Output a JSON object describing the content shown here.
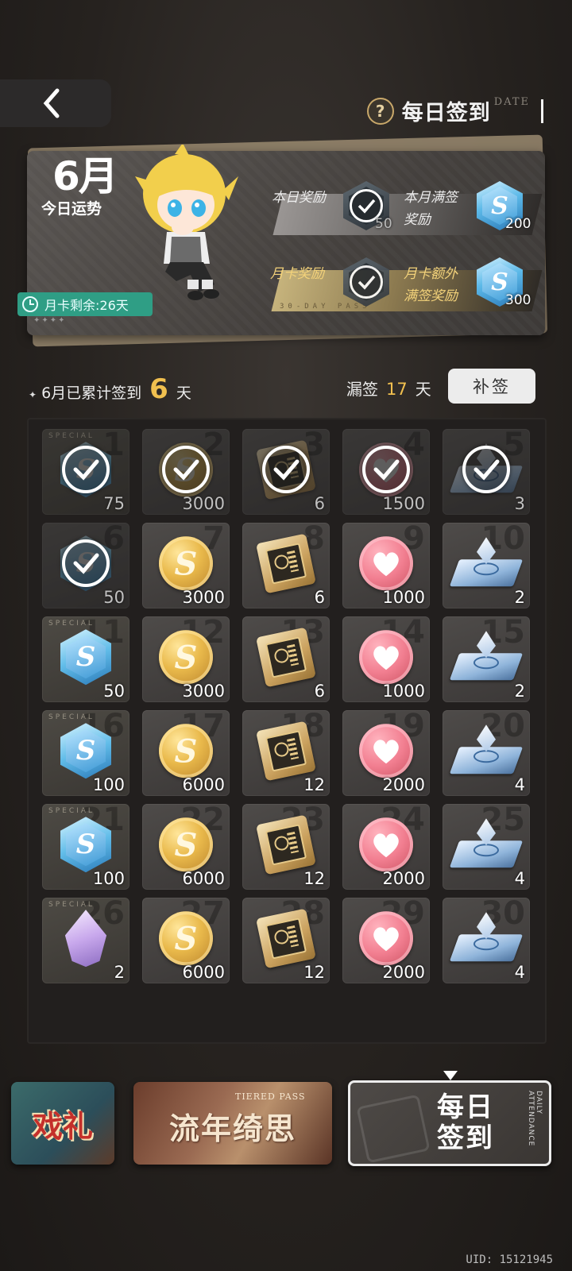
{
  "header": {
    "title": "每日签到",
    "date_tag": "DATE"
  },
  "card": {
    "month": "6月",
    "fortune": "今日运势",
    "monthly_card_remaining": "月卡剩余:26天",
    "stars": "✦✦✦✦",
    "pass_text": "30-DAY PASS",
    "rewards": {
      "daily_label": "本日奖励",
      "daily_qty": "50",
      "month_full_label_1": "本月满签",
      "month_full_label_2": "奖励",
      "month_full_qty": "200",
      "card_label": "月卡奖励",
      "card_extra_label_1": "月卡额外",
      "card_extra_label_2": "满签奖励",
      "card_extra_qty": "300"
    }
  },
  "stats": {
    "prefix": "6月已累计签到",
    "days": "6",
    "suffix": "天",
    "missed_label": "漏签",
    "missed_days": "17",
    "missed_suffix": "天",
    "makeup_button": "补签"
  },
  "grid": [
    {
      "day": "1",
      "item": "hex",
      "qty": "75",
      "special": true,
      "claimed": true
    },
    {
      "day": "2",
      "item": "coin",
      "qty": "3000",
      "special": false,
      "claimed": true
    },
    {
      "day": "3",
      "item": "chip",
      "qty": "6",
      "special": false,
      "claimed": true
    },
    {
      "day": "4",
      "item": "heart",
      "qty": "1500",
      "special": false,
      "claimed": true
    },
    {
      "day": "5",
      "item": "pad",
      "qty": "3",
      "special": false,
      "claimed": true
    },
    {
      "day": "6",
      "item": "hex",
      "qty": "50",
      "special": false,
      "claimed": true
    },
    {
      "day": "7",
      "item": "coin",
      "qty": "3000",
      "special": false,
      "claimed": false
    },
    {
      "day": "8",
      "item": "chip",
      "qty": "6",
      "special": false,
      "claimed": false
    },
    {
      "day": "9",
      "item": "heart",
      "qty": "1000",
      "special": false,
      "claimed": false
    },
    {
      "day": "10",
      "item": "pad",
      "qty": "2",
      "special": false,
      "claimed": false
    },
    {
      "day": "11",
      "item": "hex",
      "qty": "50",
      "special": true,
      "claimed": false
    },
    {
      "day": "12",
      "item": "coin",
      "qty": "3000",
      "special": false,
      "claimed": false
    },
    {
      "day": "13",
      "item": "chip",
      "qty": "6",
      "special": false,
      "claimed": false
    },
    {
      "day": "14",
      "item": "heart",
      "qty": "1000",
      "special": false,
      "claimed": false
    },
    {
      "day": "15",
      "item": "pad",
      "qty": "2",
      "special": false,
      "claimed": false
    },
    {
      "day": "16",
      "item": "hex",
      "qty": "100",
      "special": true,
      "claimed": false
    },
    {
      "day": "17",
      "item": "coin",
      "qty": "6000",
      "special": false,
      "claimed": false
    },
    {
      "day": "18",
      "item": "chip",
      "qty": "12",
      "special": false,
      "claimed": false
    },
    {
      "day": "19",
      "item": "heart",
      "qty": "2000",
      "special": false,
      "claimed": false
    },
    {
      "day": "20",
      "item": "pad",
      "qty": "4",
      "special": false,
      "claimed": false
    },
    {
      "day": "21",
      "item": "hex",
      "qty": "100",
      "special": true,
      "claimed": false
    },
    {
      "day": "22",
      "item": "coin",
      "qty": "6000",
      "special": false,
      "claimed": false
    },
    {
      "day": "23",
      "item": "chip",
      "qty": "12",
      "special": false,
      "claimed": false
    },
    {
      "day": "24",
      "item": "heart",
      "qty": "2000",
      "special": false,
      "claimed": false
    },
    {
      "day": "25",
      "item": "pad",
      "qty": "4",
      "special": false,
      "claimed": false
    },
    {
      "day": "26",
      "item": "crystal",
      "qty": "2",
      "special": true,
      "claimed": false
    },
    {
      "day": "27",
      "item": "coin",
      "qty": "6000",
      "special": false,
      "claimed": false
    },
    {
      "day": "28",
      "item": "chip",
      "qty": "12",
      "special": false,
      "claimed": false
    },
    {
      "day": "29",
      "item": "heart",
      "qty": "2000",
      "special": false,
      "claimed": false
    },
    {
      "day": "30",
      "item": "pad",
      "qty": "4",
      "special": false,
      "claimed": false
    }
  ],
  "special_tag": "SPECIAL",
  "tabs": {
    "t1_label": "戏礼",
    "t2_en": "TIERED PASS",
    "t2_label": "流年绮思",
    "t3_line1": "每日",
    "t3_line2": "签到",
    "t3_vertical": "DAILY ATTENDANCE"
  },
  "uid": "UID: 15121945"
}
